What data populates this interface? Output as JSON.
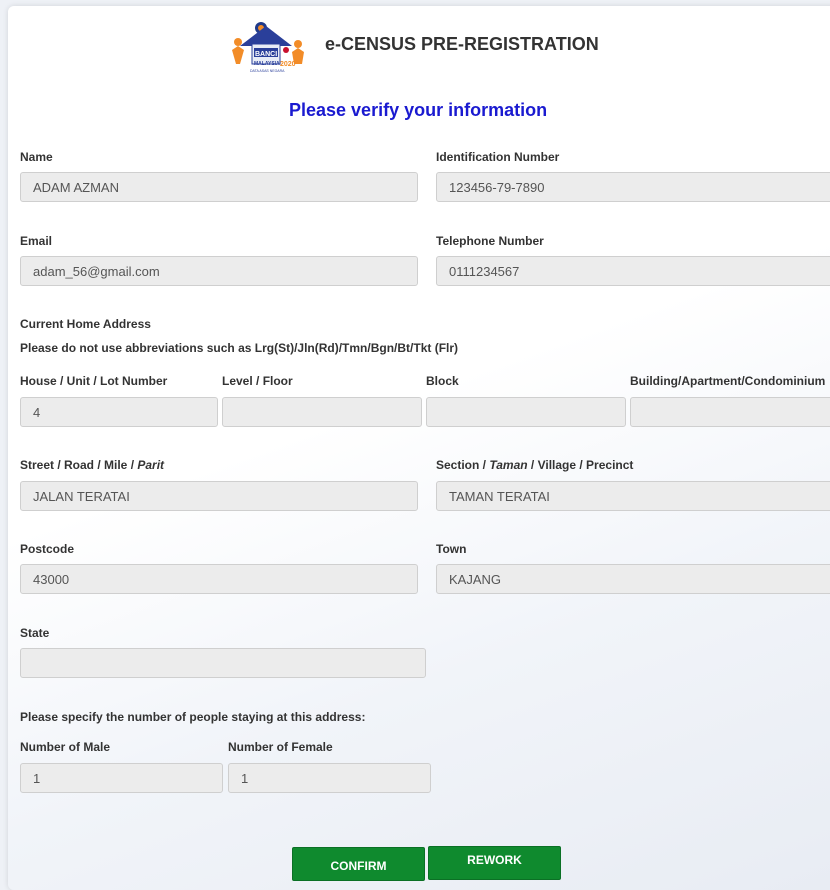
{
  "header": {
    "logo_text": "BANCI MALAYSIA 2020",
    "logo_subtext": "DATA ASAS NEGARA",
    "title": "e-CENSUS PRE-REGISTRATION",
    "heading": "Please verify your information"
  },
  "fields": {
    "name": {
      "label": "Name",
      "value": "ADAM AZMAN"
    },
    "id_number": {
      "label": "Identification Number",
      "value": "123456-79-7890"
    },
    "email": {
      "label": "Email",
      "value": "adam_56@gmail.com"
    },
    "phone": {
      "label": "Telephone Number",
      "value": "0111234567"
    },
    "house": {
      "label": "House / Unit / Lot Number",
      "value": "4"
    },
    "level": {
      "label": "Level / Floor",
      "value": ""
    },
    "block": {
      "label": "Block",
      "value": ""
    },
    "building": {
      "label": "Building/Apartment/Condominium",
      "value": ""
    },
    "street": {
      "label_main": "Street / Road / Mile / ",
      "label_italic": "Parit",
      "value": "JALAN TERATAI"
    },
    "section": {
      "label_a": "Section / ",
      "label_italic": "Taman",
      "label_b": " / Village / Precinct",
      "value": "TAMAN TERATAI"
    },
    "postcode": {
      "label": "Postcode",
      "value": "43000"
    },
    "town": {
      "label": "Town",
      "value": "KAJANG"
    },
    "state": {
      "label": "State",
      "value": ""
    },
    "male": {
      "label": "Number of Male",
      "value": "1"
    },
    "female": {
      "label": "Number of Female",
      "value": "1"
    }
  },
  "address": {
    "heading": "Current Home Address",
    "note": "Please do not use abbreviations such as Lrg(St)/Jln(Rd)/Tmn/Bgn/Bt/Tkt (Flr)"
  },
  "occupants_prompt": "Please specify the number of people staying at this address:",
  "buttons": {
    "confirm": "CONFIRM",
    "rework": "REWORK"
  },
  "colors": {
    "accent_blue": "#1a1ad0",
    "button_green": "#0f8a2e",
    "field_bg": "#ececec"
  }
}
